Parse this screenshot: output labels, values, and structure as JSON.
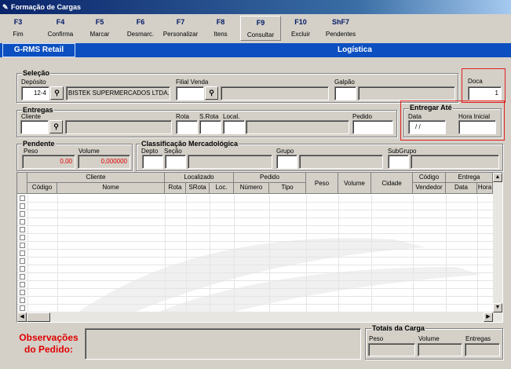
{
  "window": {
    "title": "Formação de Cargas"
  },
  "toolbar": [
    {
      "key": "F3",
      "label": "Fim"
    },
    {
      "key": "F4",
      "label": "Confirma"
    },
    {
      "key": "F5",
      "label": "Marcar"
    },
    {
      "key": "F6",
      "label": "Desmarc."
    },
    {
      "key": "F7",
      "label": "Personalizar"
    },
    {
      "key": "F8",
      "label": "Itens"
    },
    {
      "key": "F9",
      "label": "Consultar"
    },
    {
      "key": "F10",
      "label": "Excluir"
    },
    {
      "key": "ShF7",
      "label": "Pendentes"
    }
  ],
  "header": {
    "brand": "G-RMS Retail",
    "area": "Logística"
  },
  "selecao": {
    "title": "Seleção",
    "deposito_label": "Depósito",
    "deposito_value": "12-4",
    "deposito_name": "BISTEK SUPERMERCADOS LTDA.",
    "filial_label": "Filial Venda",
    "filial_value": "",
    "galpao_label": "Galpão",
    "galpao_value": "",
    "doca_label": "Doca",
    "doca_value": "1"
  },
  "entregas": {
    "title": "Entregas",
    "cliente_label": "Cliente",
    "cliente_value": "",
    "rota_label": "Rota",
    "srota_label": "S.Rota",
    "local_label": "Local.",
    "pedido_label": "Pedido",
    "pedido_value": ""
  },
  "entregar_ate": {
    "title": "Entregar Até",
    "data_label": "Data",
    "data_value": " / /",
    "hora_label": "Hora Inicial",
    "hora_value": ""
  },
  "pendente": {
    "title": "Pendente",
    "peso_label": "Peso",
    "peso_value": "0,00",
    "volume_label": "Volume",
    "volume_value": "0,000000"
  },
  "classificacao": {
    "title": "Classificação Mercadológica",
    "depto_label": "Depto",
    "secao_label": "Seção",
    "grupo_label": "Grupo",
    "subgrupo_label": "SubGrupo"
  },
  "grid": {
    "groups": [
      "Cliente",
      "Localizado",
      "Pedido",
      "Peso",
      "Volume",
      "Cidade",
      "Código",
      "Entrega"
    ],
    "columns": [
      "Código",
      "Nome",
      "Rota",
      "SRota",
      "Loc.",
      "Número",
      "Tipo",
      "Vendedor",
      "Data",
      "Hora"
    ],
    "row_count": 15
  },
  "observacoes": {
    "label_line1": "Observações",
    "label_line2": "do Pedido:"
  },
  "totais": {
    "title": "Totais da Carga",
    "peso_label": "Peso",
    "volume_label": "Volume",
    "entregas_label": "Entregas"
  }
}
